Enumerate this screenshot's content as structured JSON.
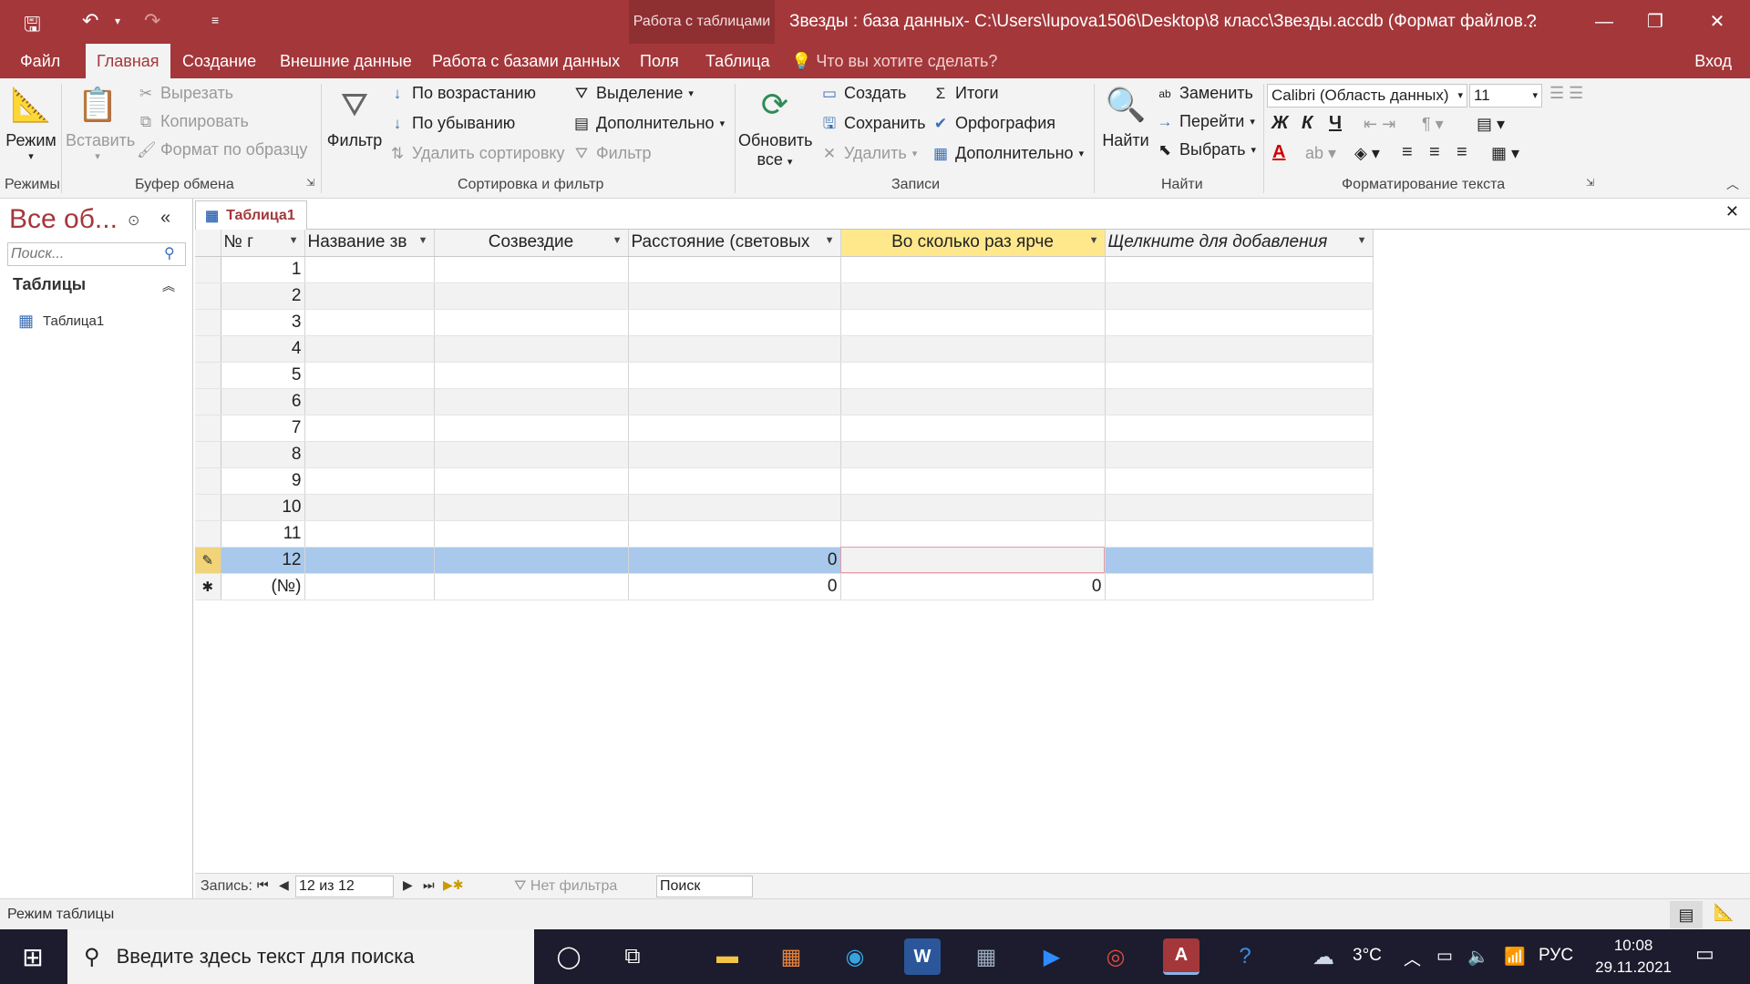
{
  "titlebar": {
    "context_tools": "Работа с таблицами",
    "window_title": "Звезды : база данных- C:\\Users\\lupova1506\\Desktop\\8 класс\\Звезды.accdb (Формат файлов...",
    "help": "?"
  },
  "menu": {
    "tabs": [
      "Файл",
      "Главная",
      "Создание",
      "Внешние данные",
      "Работа с базами данных",
      "Поля",
      "Таблица"
    ],
    "active_tab": "Главная",
    "tell_me": "Что вы хотите сделать?",
    "sign_in": "Вход"
  },
  "ribbon": {
    "views": {
      "mode": "Режим",
      "label": "Режимы"
    },
    "clipboard": {
      "paste": "Вставить",
      "cut": "Вырезать",
      "copy": "Копировать",
      "format_painter": "Формат по образцу",
      "label": "Буфер обмена"
    },
    "sort_filter": {
      "filter": "Фильтр",
      "ascending": "По возрастанию",
      "descending": "По убыванию",
      "remove_sort": "Удалить сортировку",
      "selection": "Выделение",
      "advanced": "Дополнительно",
      "toggle_filter": "Фильтр",
      "label": "Сортировка и фильтр"
    },
    "records": {
      "refresh": "Обновить",
      "refresh2": "все",
      "new": "Создать",
      "save": "Сохранить",
      "delete": "Удалить",
      "totals": "Итоги",
      "spelling": "Орфография",
      "more": "Дополнительно",
      "label": "Записи"
    },
    "find": {
      "find": "Найти",
      "replace": "Заменить",
      "goto": "Перейти",
      "select": "Выбрать",
      "label": "Найти"
    },
    "text_format": {
      "font": "Calibri (Область данных)",
      "size": "11",
      "bold": "Ж",
      "italic": "К",
      "underline": "Ч",
      "font_color": "A",
      "label": "Форматирование текста"
    }
  },
  "nav": {
    "title": "Все об...",
    "search_placeholder": "Поиск...",
    "group": "Таблицы",
    "item": "Таблица1"
  },
  "document": {
    "tab": "Таблица1",
    "columns": [
      "№ г",
      "Название зв",
      "Созвездие",
      "Расстояние (световых",
      "Во сколько раз ярче",
      "Щелкните для добавления"
    ],
    "rows": [
      [
        "1",
        "",
        "",
        "",
        "",
        ""
      ],
      [
        "2",
        "",
        "",
        "",
        "",
        ""
      ],
      [
        "3",
        "",
        "",
        "",
        "",
        ""
      ],
      [
        "4",
        "",
        "",
        "",
        "",
        ""
      ],
      [
        "5",
        "",
        "",
        "",
        "",
        ""
      ],
      [
        "6",
        "",
        "",
        "",
        "",
        ""
      ],
      [
        "7",
        "",
        "",
        "",
        "",
        ""
      ],
      [
        "8",
        "",
        "",
        "",
        "",
        ""
      ],
      [
        "9",
        "",
        "",
        "",
        "",
        ""
      ],
      [
        "10",
        "",
        "",
        "",
        "",
        ""
      ],
      [
        "11",
        "",
        "",
        "",
        "",
        ""
      ],
      [
        "12",
        "",
        "",
        "0",
        "",
        ""
      ],
      [
        "(№)",
        "",
        "",
        "0",
        "0",
        ""
      ]
    ],
    "new_row_marker": "✱",
    "edit_marker": "✎"
  },
  "record_nav": {
    "label": "Запись:",
    "position": "12 из 12",
    "filter": "Нет фильтра",
    "search": "Поиск"
  },
  "status": {
    "text": "Режим таблицы"
  },
  "taskbar": {
    "search_placeholder": "Введите здесь текст для поиска",
    "weather": "3°C",
    "lang": "РУС",
    "time": "10:08",
    "date": "29.11.2021"
  },
  "colors": {
    "accent": "#a4373a",
    "header_highlight": "#ffe88c",
    "current_row": "#a9c9ec"
  }
}
